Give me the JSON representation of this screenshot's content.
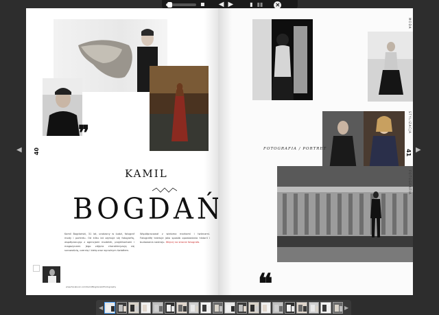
{
  "toolbar": {
    "zoom_level": 0.12,
    "prev_icon": "triangle-left-icon",
    "next_icon": "triangle-right-icon",
    "single_page_icon": "single-page-icon",
    "double_page_icon": "double-page-icon",
    "close_icon": "close-icon"
  },
  "navigation": {
    "left_arrow": "◀",
    "right_arrow": "▶"
  },
  "left_page": {
    "page_number": "40",
    "title_first": "KAMIL",
    "title_last": "BOGDAŃSKI",
    "column_left": "Kamil Bogdański, 31 lat, urodzony w Łodzi, fotograf mody i portretu. Od kilku lat zajmuje się fotografią, współpracując z agencjami modelek, projektantami i magazynami. Jego zdjęcia charakteryzują się surowością, czernią i bielą oraz wyraźnym światłem.",
    "column_right": "Współpracował z wieloma markami i twórcami. Fotografię traktuje jako sposób opowiadania historii i budowania nastroju.",
    "highlight_text": "Więcej na stronie fotografa.",
    "credit": "www.facebook.com/KamilBogdanskiPhotography"
  },
  "right_page": {
    "page_number": "41",
    "tagline": "FOTOGRAFIA / PORTRET",
    "side_top": "MODA",
    "side_mid": "STYLIZACJA",
    "side_bottom": "FOTOGRAFIA"
  },
  "thumbnails": {
    "count": 20,
    "active_index": 0,
    "prev_arrow": "◀",
    "next_arrow": "▶"
  },
  "colors": {
    "toolbar_bg": "#1a1a1a",
    "viewer_bg": "#2d2d2d",
    "page_bg": "#ffffff",
    "active_thumb": "#4aa3ff"
  }
}
